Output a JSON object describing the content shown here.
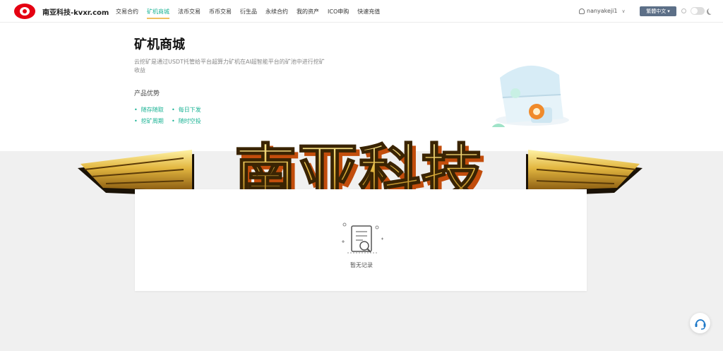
{
  "nav": {
    "brand": "南亚科技-kvxr.com",
    "menu": [
      "交易合约",
      "矿机商城",
      "法币交易",
      "币币交易",
      "衍生品",
      "永续合约",
      "我的资产",
      "ICO申购",
      "快速充值"
    ],
    "active_index": 1,
    "username": "nanyakeji1",
    "language": "繁體中文"
  },
  "hero": {
    "title": "矿机商城",
    "description": "云挖矿是通过USDT托管给平台超算力矿机在AI超智能平台的矿池中进行挖矿收益",
    "advantages_title": "产品优势",
    "advantages": [
      "随存随取",
      "每日下发",
      "挖矿周期",
      "随时空投"
    ]
  },
  "banner": {
    "text": "南亚科技"
  },
  "records": {
    "empty_text": "暂无记录"
  },
  "colors": {
    "accent": "#1ab394",
    "brand": "#e50012",
    "lang_button": "#5c6f87"
  },
  "icons": [
    "user-icon",
    "chevron-down-icon",
    "sun-icon",
    "moon-icon",
    "treasure-chest-icon",
    "empty-record-icon",
    "customer-service-icon"
  ]
}
